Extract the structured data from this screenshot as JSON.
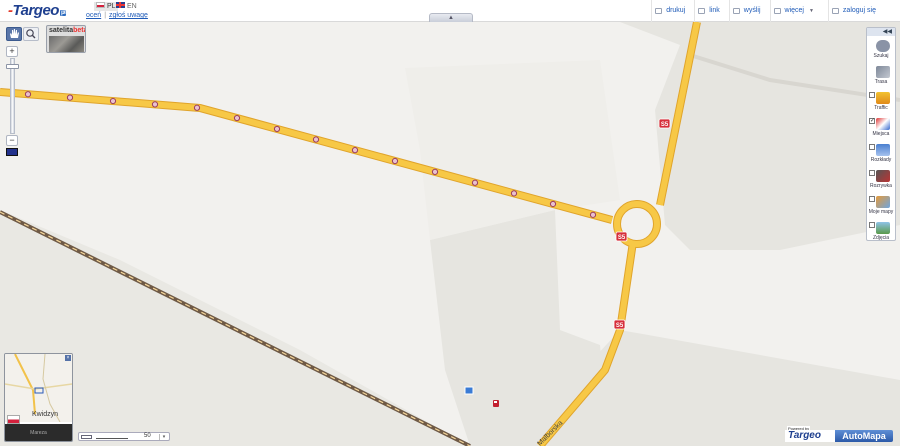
{
  "header": {
    "logo_text": "Targeo",
    "logo_tld": "pl",
    "lang_pl": "PL",
    "lang_en": "EN",
    "links": {
      "rate": "oceń",
      "separator": "|",
      "report": "zgłoś uwagę"
    },
    "handle_glyph": "▲",
    "actions": [
      {
        "label": "drukuj",
        "icon": "print-icon"
      },
      {
        "label": "link",
        "icon": "link-icon"
      },
      {
        "label": "wyślij",
        "icon": "send-icon"
      },
      {
        "label": "więcej",
        "icon": "more-icon",
        "caret": "▼"
      },
      {
        "label": "zaloguj się",
        "icon": "user-icon"
      }
    ]
  },
  "map": {
    "satellite": {
      "label": "satelita",
      "beta": "beta"
    },
    "zoom": {
      "plus": "+",
      "minus": "−",
      "level": 0.08
    },
    "road_shields": [
      "S5",
      "S5",
      "S5"
    ],
    "street_label": "Malborska",
    "colors": {
      "background": "#f2f1ee",
      "land": "#e6e5e0",
      "road": "#f7c23e",
      "road_casing": "#e4a52a",
      "railway": "#5a4430",
      "marker": "#9b3d5e"
    }
  },
  "tools": [
    {
      "label": "Szukaj",
      "icon": "search-icon",
      "checkbox": false
    },
    {
      "label": "Trasa",
      "icon": "route-icon",
      "checkbox": false
    },
    {
      "label": "Traffic",
      "icon": "traffic-icon",
      "checkbox": true,
      "checked": false
    },
    {
      "label": "Miejsca",
      "icon": "places-icon",
      "checkbox": true,
      "checked": true
    },
    {
      "label": "Rozkłady",
      "icon": "timetable-icon",
      "checkbox": true,
      "checked": false
    },
    {
      "label": "Rozrywka",
      "icon": "entertainment-icon",
      "checkbox": true,
      "checked": false
    },
    {
      "label": "Moje mapy",
      "icon": "my-maps-icon",
      "checkbox": true,
      "checked": false
    },
    {
      "label": "Zdjęcia",
      "icon": "photos-icon",
      "checkbox": true,
      "checked": false
    }
  ],
  "minimap": {
    "city": "Kwidzyn",
    "region": "Mareza",
    "close": "×"
  },
  "scale": {
    "value": "50",
    "drop": "▾"
  },
  "powered": {
    "text": "Powered by",
    "logo": "Targeo",
    "product": "AutoMapa"
  }
}
